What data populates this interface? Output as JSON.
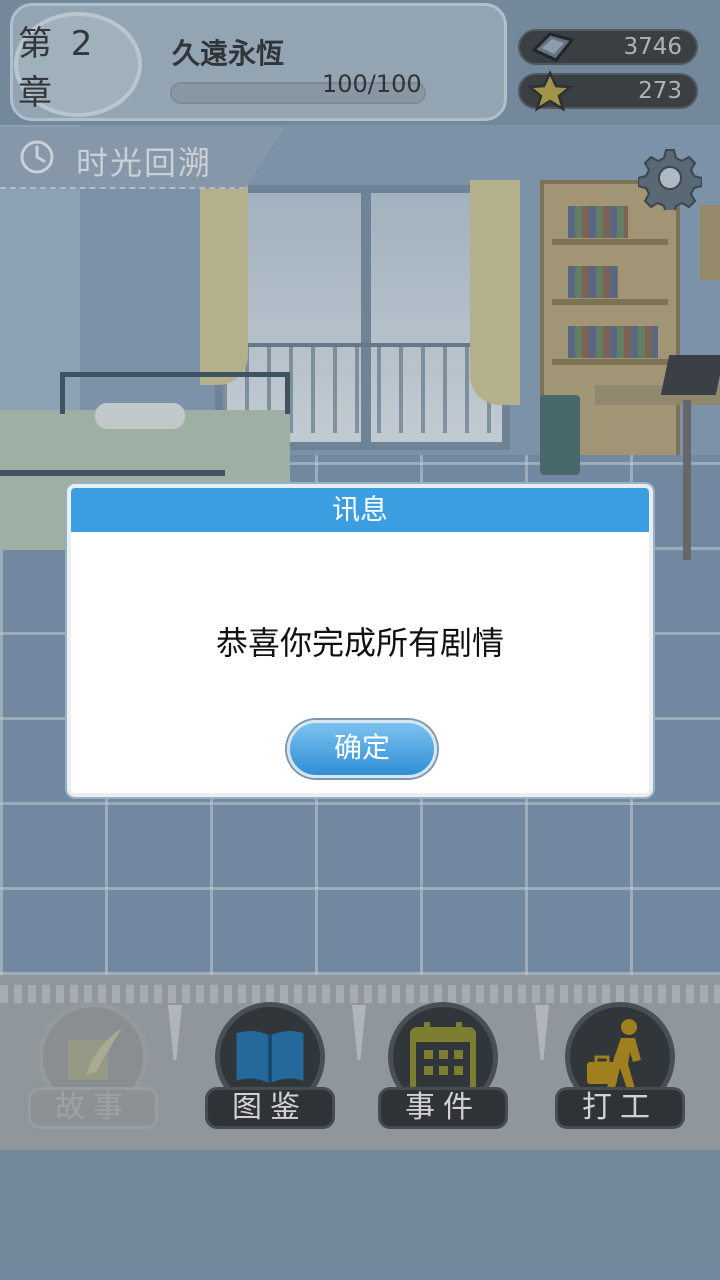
{
  "header": {
    "chapter_label": "第 2 章",
    "chapter_title": "久遠永恆",
    "progress_text": "100/100",
    "progress_fraction": 1.0,
    "currency_gems": "3746",
    "currency_stars": "273"
  },
  "time_tab": {
    "label": "时光回溯",
    "icon": "clock-icon"
  },
  "settings": {
    "icon": "gear-icon"
  },
  "dialog": {
    "title": "讯息",
    "message": "恭喜你完成所有剧情",
    "ok_label": "确定"
  },
  "bottom_nav": [
    {
      "label": "故事",
      "icon": "scroll-quill-icon",
      "enabled": false
    },
    {
      "label": "图鉴",
      "icon": "book-icon",
      "enabled": true
    },
    {
      "label": "事件",
      "icon": "calendar-icon",
      "enabled": true
    },
    {
      "label": "打工",
      "icon": "walking-worker-icon",
      "enabled": true
    }
  ],
  "colors": {
    "dialog_header": "#3b9ee0",
    "ok_button": "#2f8fd6",
    "book_icon": "#1f6fae",
    "calendar_icon": "#8c8a2c",
    "worker_icon": "#b58b14"
  }
}
